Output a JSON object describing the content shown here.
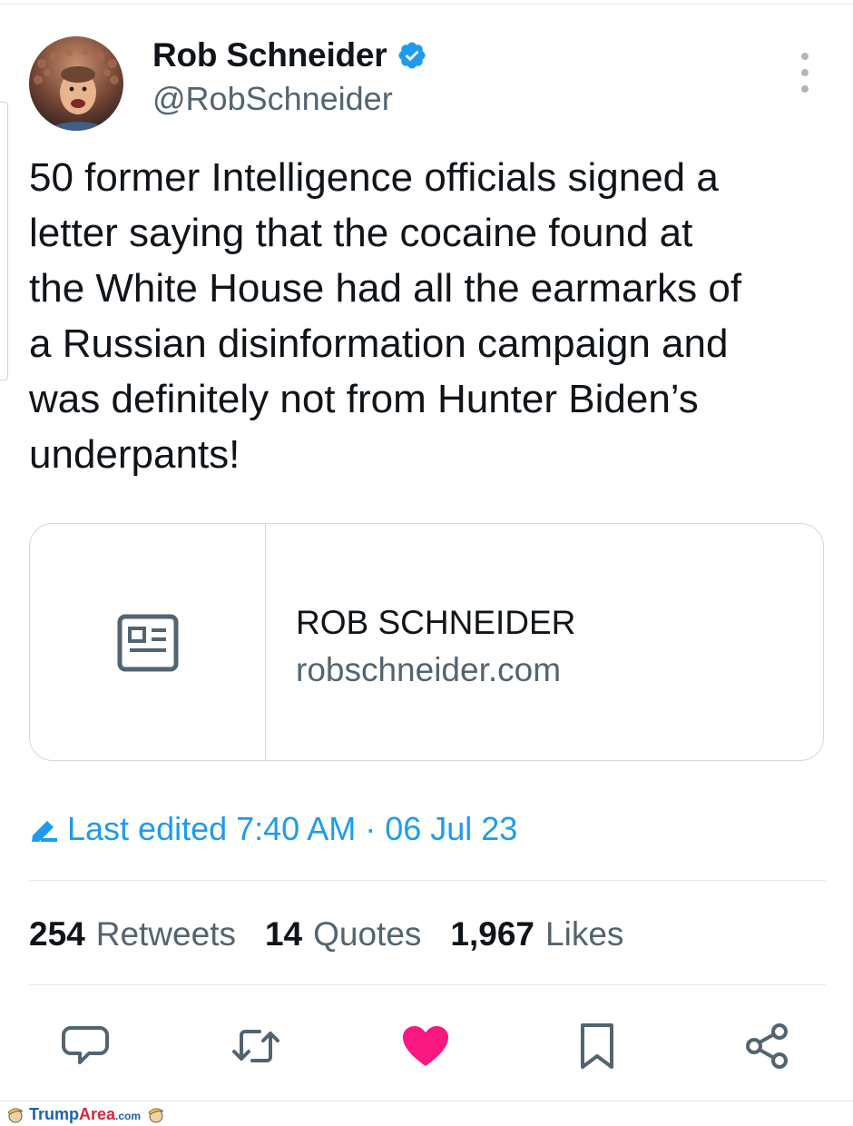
{
  "author": {
    "display_name": "Rob Schneider",
    "handle": "@RobSchneider",
    "verified": true
  },
  "tweet": {
    "text_lines": [
      "50 former Intelligence officials signed a",
      "letter saying that the cocaine found at",
      "the White House had all the earmarks of",
      "a Russian disinformation campaign and",
      "was definitely not from Hunter Biden’s",
      "underpants!"
    ]
  },
  "link_card": {
    "title": "ROB SCHNEIDER",
    "domain": "robschneider.com",
    "icon": "article-icon"
  },
  "edit_info": {
    "label": "Last edited 7:40 AM · 06 Jul 23",
    "icon": "pencil-icon"
  },
  "stats": [
    {
      "count": "254",
      "label": "Retweets"
    },
    {
      "count": "14",
      "label": "Quotes"
    },
    {
      "count": "1,967",
      "label": "Likes"
    }
  ],
  "actions": [
    {
      "name": "reply",
      "icon": "reply-icon"
    },
    {
      "name": "retweet",
      "icon": "retweet-icon"
    },
    {
      "name": "like",
      "icon": "heart-icon",
      "active": true
    },
    {
      "name": "bookmark",
      "icon": "bookmark-icon"
    },
    {
      "name": "share",
      "icon": "share-icon"
    }
  ],
  "watermark": {
    "brand_part1": "Trump",
    "brand_part2": "Area",
    "suffix": ".com"
  },
  "colors": {
    "accent": "#1d9bf0",
    "like": "#f91880",
    "text_primary": "#0f1419",
    "text_secondary": "#536471",
    "border": "#cfd9de"
  }
}
